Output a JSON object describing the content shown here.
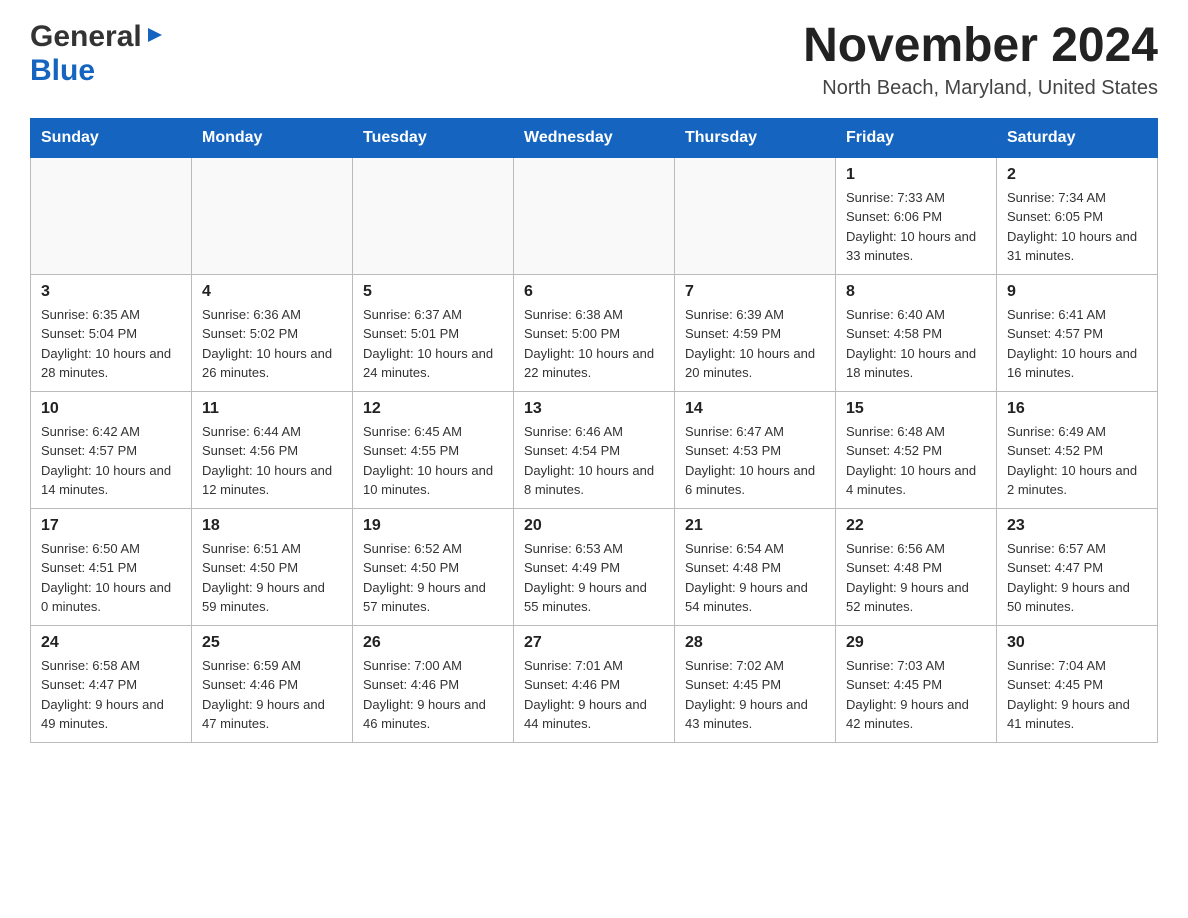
{
  "header": {
    "logo_general": "General",
    "logo_blue": "Blue",
    "month_title": "November 2024",
    "location": "North Beach, Maryland, United States"
  },
  "days_of_week": [
    "Sunday",
    "Monday",
    "Tuesday",
    "Wednesday",
    "Thursday",
    "Friday",
    "Saturday"
  ],
  "weeks": [
    [
      {
        "day": "",
        "info": ""
      },
      {
        "day": "",
        "info": ""
      },
      {
        "day": "",
        "info": ""
      },
      {
        "day": "",
        "info": ""
      },
      {
        "day": "",
        "info": ""
      },
      {
        "day": "1",
        "info": "Sunrise: 7:33 AM\nSunset: 6:06 PM\nDaylight: 10 hours and 33 minutes."
      },
      {
        "day": "2",
        "info": "Sunrise: 7:34 AM\nSunset: 6:05 PM\nDaylight: 10 hours and 31 minutes."
      }
    ],
    [
      {
        "day": "3",
        "info": "Sunrise: 6:35 AM\nSunset: 5:04 PM\nDaylight: 10 hours and 28 minutes."
      },
      {
        "day": "4",
        "info": "Sunrise: 6:36 AM\nSunset: 5:02 PM\nDaylight: 10 hours and 26 minutes."
      },
      {
        "day": "5",
        "info": "Sunrise: 6:37 AM\nSunset: 5:01 PM\nDaylight: 10 hours and 24 minutes."
      },
      {
        "day": "6",
        "info": "Sunrise: 6:38 AM\nSunset: 5:00 PM\nDaylight: 10 hours and 22 minutes."
      },
      {
        "day": "7",
        "info": "Sunrise: 6:39 AM\nSunset: 4:59 PM\nDaylight: 10 hours and 20 minutes."
      },
      {
        "day": "8",
        "info": "Sunrise: 6:40 AM\nSunset: 4:58 PM\nDaylight: 10 hours and 18 minutes."
      },
      {
        "day": "9",
        "info": "Sunrise: 6:41 AM\nSunset: 4:57 PM\nDaylight: 10 hours and 16 minutes."
      }
    ],
    [
      {
        "day": "10",
        "info": "Sunrise: 6:42 AM\nSunset: 4:57 PM\nDaylight: 10 hours and 14 minutes."
      },
      {
        "day": "11",
        "info": "Sunrise: 6:44 AM\nSunset: 4:56 PM\nDaylight: 10 hours and 12 minutes."
      },
      {
        "day": "12",
        "info": "Sunrise: 6:45 AM\nSunset: 4:55 PM\nDaylight: 10 hours and 10 minutes."
      },
      {
        "day": "13",
        "info": "Sunrise: 6:46 AM\nSunset: 4:54 PM\nDaylight: 10 hours and 8 minutes."
      },
      {
        "day": "14",
        "info": "Sunrise: 6:47 AM\nSunset: 4:53 PM\nDaylight: 10 hours and 6 minutes."
      },
      {
        "day": "15",
        "info": "Sunrise: 6:48 AM\nSunset: 4:52 PM\nDaylight: 10 hours and 4 minutes."
      },
      {
        "day": "16",
        "info": "Sunrise: 6:49 AM\nSunset: 4:52 PM\nDaylight: 10 hours and 2 minutes."
      }
    ],
    [
      {
        "day": "17",
        "info": "Sunrise: 6:50 AM\nSunset: 4:51 PM\nDaylight: 10 hours and 0 minutes."
      },
      {
        "day": "18",
        "info": "Sunrise: 6:51 AM\nSunset: 4:50 PM\nDaylight: 9 hours and 59 minutes."
      },
      {
        "day": "19",
        "info": "Sunrise: 6:52 AM\nSunset: 4:50 PM\nDaylight: 9 hours and 57 minutes."
      },
      {
        "day": "20",
        "info": "Sunrise: 6:53 AM\nSunset: 4:49 PM\nDaylight: 9 hours and 55 minutes."
      },
      {
        "day": "21",
        "info": "Sunrise: 6:54 AM\nSunset: 4:48 PM\nDaylight: 9 hours and 54 minutes."
      },
      {
        "day": "22",
        "info": "Sunrise: 6:56 AM\nSunset: 4:48 PM\nDaylight: 9 hours and 52 minutes."
      },
      {
        "day": "23",
        "info": "Sunrise: 6:57 AM\nSunset: 4:47 PM\nDaylight: 9 hours and 50 minutes."
      }
    ],
    [
      {
        "day": "24",
        "info": "Sunrise: 6:58 AM\nSunset: 4:47 PM\nDaylight: 9 hours and 49 minutes."
      },
      {
        "day": "25",
        "info": "Sunrise: 6:59 AM\nSunset: 4:46 PM\nDaylight: 9 hours and 47 minutes."
      },
      {
        "day": "26",
        "info": "Sunrise: 7:00 AM\nSunset: 4:46 PM\nDaylight: 9 hours and 46 minutes."
      },
      {
        "day": "27",
        "info": "Sunrise: 7:01 AM\nSunset: 4:46 PM\nDaylight: 9 hours and 44 minutes."
      },
      {
        "day": "28",
        "info": "Sunrise: 7:02 AM\nSunset: 4:45 PM\nDaylight: 9 hours and 43 minutes."
      },
      {
        "day": "29",
        "info": "Sunrise: 7:03 AM\nSunset: 4:45 PM\nDaylight: 9 hours and 42 minutes."
      },
      {
        "day": "30",
        "info": "Sunrise: 7:04 AM\nSunset: 4:45 PM\nDaylight: 9 hours and 41 minutes."
      }
    ]
  ]
}
